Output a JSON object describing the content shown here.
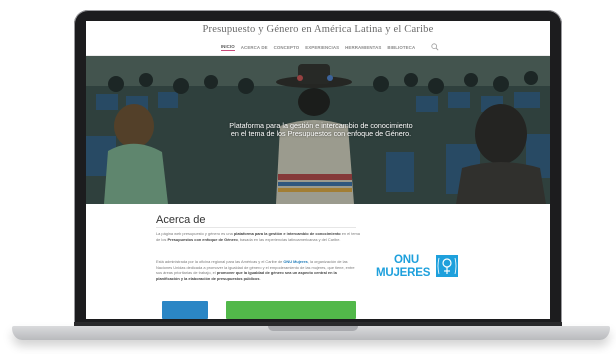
{
  "site": {
    "title": "Presupuesto y Género en América Latina y el Caribe"
  },
  "nav": {
    "items": [
      {
        "label": "INICIO",
        "active": true
      },
      {
        "label": "ACERCA DE"
      },
      {
        "label": "CONCEPTO"
      },
      {
        "label": "EXPERIENCIAS"
      },
      {
        "label": "HERRAMIENTAS"
      },
      {
        "label": "BIBLIOTECA"
      }
    ],
    "search_icon": "search-icon"
  },
  "hero": {
    "line1": "Plataforma para la gestión e intercambio de conocimiento",
    "line2": "en el tema de los Presupuestos con enfoque de Género."
  },
  "about": {
    "title": "Acerca de",
    "p1": {
      "a": "La página web presupuesto y género es una ",
      "b": "plataforma para la gestión e intercambio de conocimiento",
      "c": " en el tema de los ",
      "d": "Presupuestos con enfoque de Género",
      "e": ", basada en las experiencias latinoamericanas y del Caribe."
    },
    "p2": {
      "a": "Está administrada por la oficina regional para las Américas y el Caribe de ",
      "b": "ONU Mujeres",
      "c": ", la organización de las Naciones Unidas dedicada a promover la igualdad de género y el empoderamiento de las mujeres, que tiene, entre sus áreas prioritarias de trabajo, el ",
      "d": "promover que la igualdad de género sea un aspecto central en la planificación y la elaboración de presupuestos públicos",
      "e": "."
    }
  },
  "logo": {
    "onu": "ONU",
    "mujeres": "MUJERES"
  },
  "colors": {
    "accent_pink": "#c84b7a",
    "link_blue": "#1d7ab8",
    "button_blue": "#2b86c5",
    "button_green": "#52b84a",
    "logo_blue": "#1ea0dc"
  }
}
